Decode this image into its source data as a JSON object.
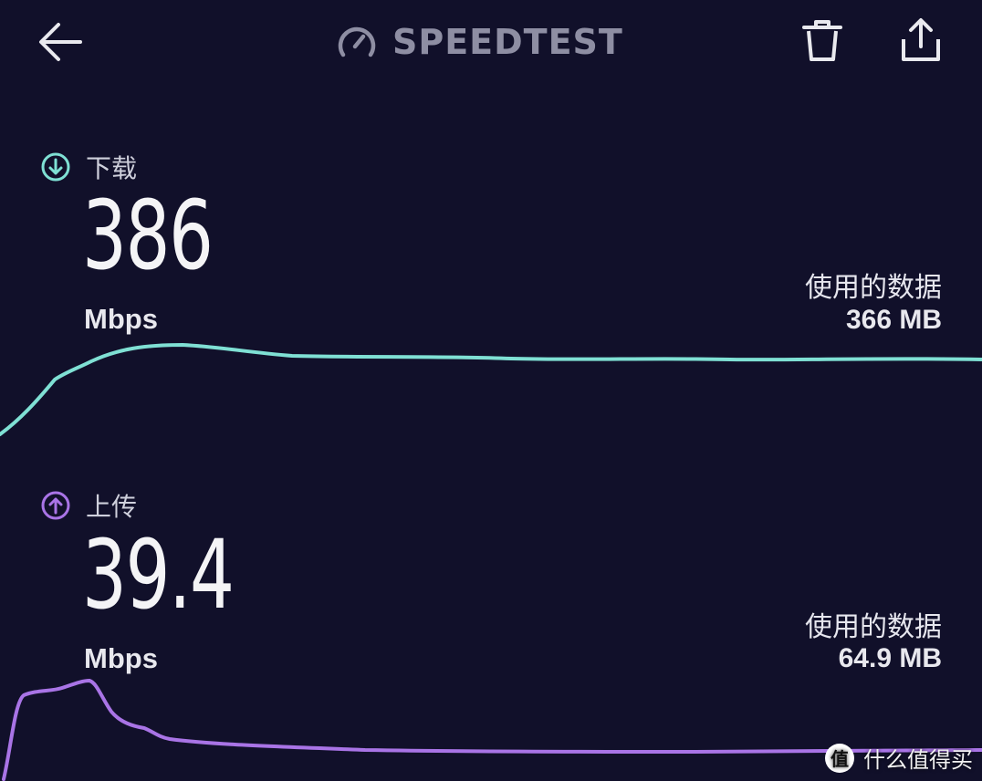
{
  "header": {
    "title": "SPEEDTEST"
  },
  "icons": {
    "back": "arrow-left-icon",
    "logo": "speedometer-icon",
    "trash": "trash-icon",
    "share": "share-icon",
    "download": "arrow-down-circle-icon",
    "upload": "arrow-up-circle-icon"
  },
  "colors": {
    "background": "#11102a",
    "download_accent": "#7fe0d4",
    "upload_accent": "#a974e6",
    "title_gray": "#8e8ea3"
  },
  "download": {
    "label": "下载",
    "value": "386",
    "unit": "Mbps",
    "data_used_label": "使用的数据",
    "data_used_value": "366 MB"
  },
  "upload": {
    "label": "上传",
    "value": "39.4",
    "unit": "Mbps",
    "data_used_label": "使用的数据",
    "data_used_value": "64.9 MB"
  },
  "watermark": {
    "badge": "值",
    "text": "什么值得买"
  }
}
